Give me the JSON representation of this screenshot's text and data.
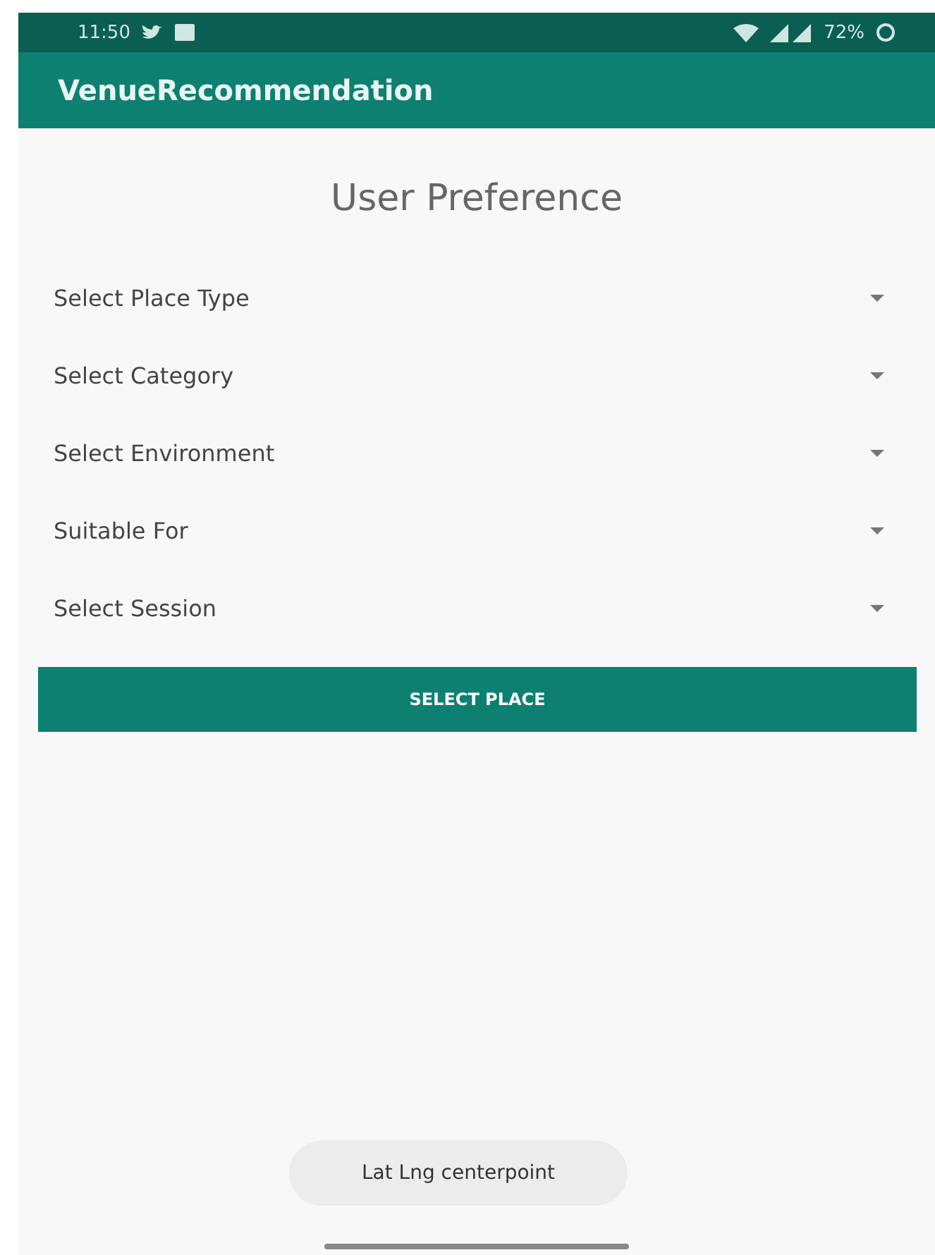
{
  "status_bar": {
    "time": "11:50",
    "battery": "72%"
  },
  "app_bar": {
    "title": "VenueRecommendation"
  },
  "heading": "User Preference",
  "dropdowns": [
    {
      "label": "Select Place Type"
    },
    {
      "label": "Select Category"
    },
    {
      "label": "Select Environment"
    },
    {
      "label": "Suitable For"
    },
    {
      "label": "Select Session"
    }
  ],
  "button": "SELECT PLACE",
  "toast": "Lat Lng centerpoint"
}
